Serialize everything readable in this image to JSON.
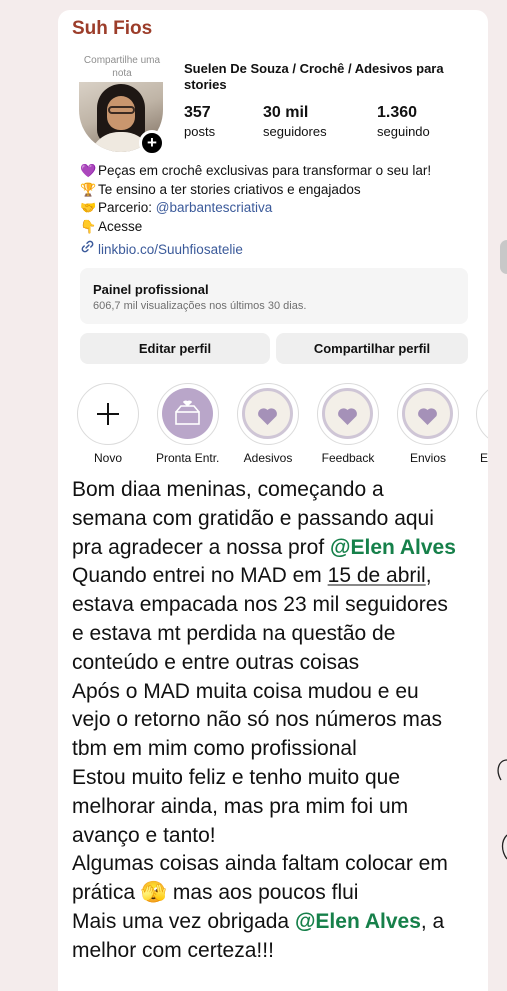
{
  "profile": {
    "brand": "Suh Fios",
    "note_label": "Compartilhe uma nota",
    "full_name": "Suelen De Souza / Crochê / Adesivos para stories",
    "posts_count": "357",
    "posts_label": "posts",
    "followers_count": "30 mil",
    "followers_label": "seguidores",
    "following_count": "1.360",
    "following_label": "seguindo"
  },
  "bio": {
    "line1_emoji": "💜",
    "line1": "Peças em crochê exclusivas para transformar o seu lar!",
    "line2_emoji": "🏆",
    "line2": "Te ensino a ter stories criativos e engajados",
    "line3_emoji": "🤝",
    "line3_prefix": "Parcerio: ",
    "line3_mention": "@barbantescriativa",
    "line4_emoji": "👇",
    "line4": "Acesse",
    "link": "linkbio.co/Suuhfiosatelie"
  },
  "dashboard": {
    "title": "Painel profissional",
    "subtitle": "606,7 mil visualizações nos últimos 30 dias."
  },
  "buttons": {
    "edit": "Editar perfil",
    "share": "Compartilhar perfil"
  },
  "highlights": [
    {
      "label": "Novo"
    },
    {
      "label": "Pronta Entr..."
    },
    {
      "label": "Adesivos"
    },
    {
      "label": "Feedback"
    },
    {
      "label": "Envios"
    },
    {
      "label": "E"
    }
  ],
  "caption": {
    "l1": "Bom diaa meninas, começando a",
    "l2": "semana com gratidão e passando aqui",
    "l3_prefix": "pra agradecer a nossa prof ",
    "mention": "@Elen Alves",
    "l4_prefix": "Quando entrei no MAD em ",
    "l4_date": "15 de abril",
    "l4_suffix": ",",
    "l5": "estava empacada nos 23 mil seguidores",
    "l6": "e estava mt perdida na questão de",
    "l7": "conteúdo e entre outras coisas",
    "l8": "Após o MAD muita coisa mudou e eu",
    "l9": "vejo o retorno não só nos números mas",
    "l10": "tbm em mim como profissional",
    "l11": "Estou muito feliz e tenho muito que",
    "l12": "melhorar ainda, mas pra mim foi um",
    "l13": "avanço e tanto!",
    "l14": "Algumas coisas ainda faltam colocar em",
    "l15_prefix": "prática ",
    "l15_emoji": "🫣",
    "l15_suffix": " mas aos poucos flui",
    "l16_prefix": "Mais uma vez obrigada ",
    "l16_suffix": ", a",
    "l17": "melhor com certeza!!!"
  },
  "colors": {
    "brand": "#9c3d2a",
    "mention_green": "#16804a",
    "link_blue": "#3b5a9a",
    "highlight_lilac": "#b9a6c9"
  }
}
